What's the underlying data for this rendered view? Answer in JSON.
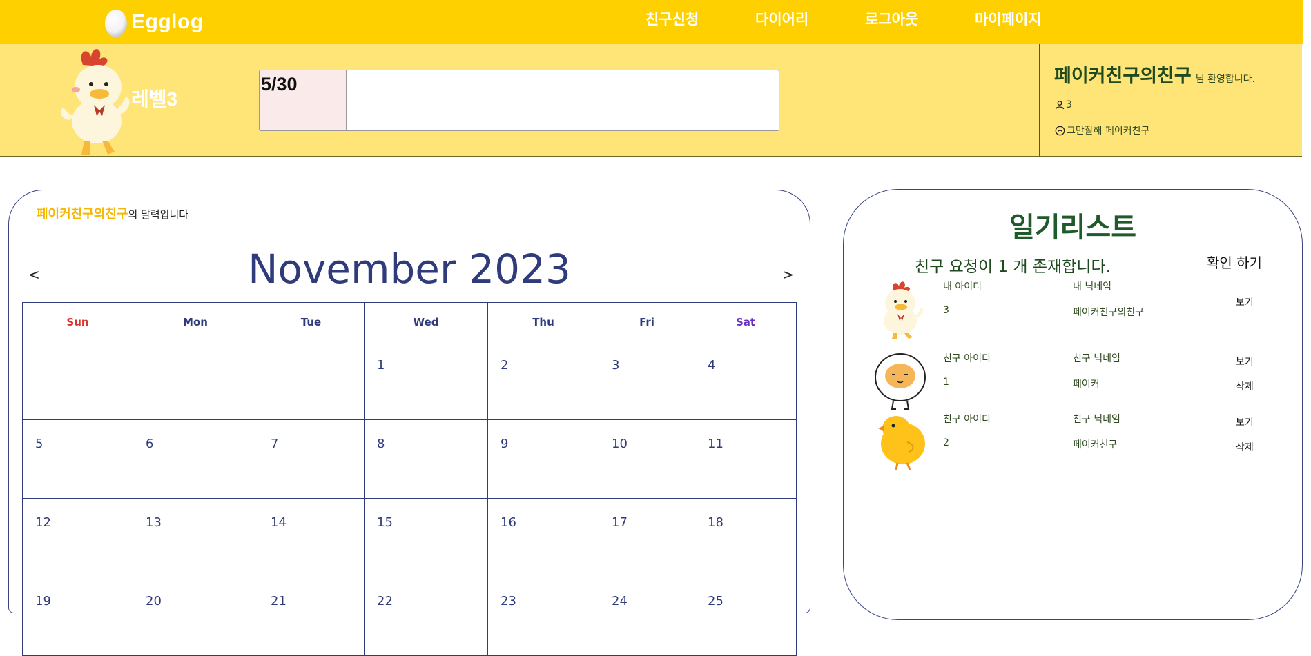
{
  "app": {
    "logo_text": "Egglog"
  },
  "nav": [
    {
      "label": "친구신청"
    },
    {
      "label": "다이어리"
    },
    {
      "label": "로그아웃"
    },
    {
      "label": "마이페이지"
    }
  ],
  "profile": {
    "level": "레벨3",
    "progress_label": "5/30",
    "progress_fraction": 0.1667,
    "username": "페이커친구의친구",
    "welcome": "님 환영합니다.",
    "friend_count": "3",
    "status_message": "그만잘해 페이커친구"
  },
  "calendar": {
    "owner_nick": "페이커친구의친구",
    "caption_suffix": "의 달력입니다",
    "title": "November 2023",
    "prev": "<",
    "next": ">",
    "weekdays": [
      "Sun",
      "Mon",
      "Tue",
      "Wed",
      "Thu",
      "Fri",
      "Sat"
    ],
    "weeks": [
      [
        "",
        "",
        "",
        "1",
        "2",
        "3",
        "4"
      ],
      [
        "5",
        "6",
        "7",
        "8",
        "9",
        "10",
        "11"
      ],
      [
        "12",
        "13",
        "14",
        "15",
        "16",
        "17",
        "18"
      ],
      [
        "19",
        "20",
        "21",
        "22",
        "23",
        "24",
        "25"
      ]
    ]
  },
  "diary_list": {
    "title": "일기리스트",
    "request_notice": "친구 요청이 1 개 존재합니다.",
    "confirm_label": "확인 하기",
    "rows": [
      {
        "id_header": "내 아이디",
        "nick_header": "내 닉네임",
        "id": "3",
        "nick": "페이커친구의친구",
        "view": "보기",
        "avatar": "chicken-avatar"
      },
      {
        "id_header": "친구 아이디",
        "nick_header": "친구 닉네임",
        "id": "1",
        "nick": "페이커",
        "view": "보기",
        "delete": "삭제",
        "avatar": "egg-avatar"
      },
      {
        "id_header": "친구 아이디",
        "nick_header": "친구 닉네임",
        "id": "2",
        "nick": "페이커친구",
        "view": "보기",
        "delete": "삭제",
        "avatar": "chick-avatar"
      }
    ]
  },
  "colors": {
    "nav_bg": "#ffd000",
    "band_bg": "#ffe477",
    "calendar_accent": "#2f3b7a",
    "title_green": "#1f5a2a"
  }
}
